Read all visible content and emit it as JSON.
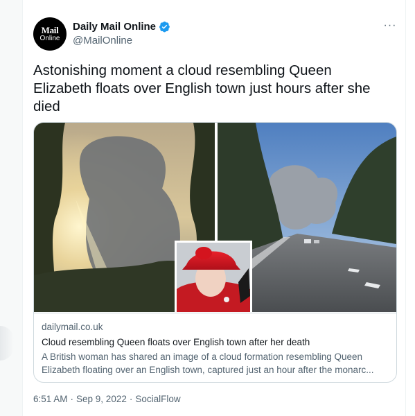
{
  "author": {
    "display_name": "Daily Mail Online",
    "handle": "@MailOnline",
    "avatar_text_line1": "Mail",
    "avatar_text_line2": "Online",
    "verified_icon": "verified-badge-icon"
  },
  "more_label": "···",
  "tweet": {
    "text": "Astonishing moment a cloud resembling Queen Elizabeth floats over English town just hours after she died"
  },
  "card": {
    "domain": "dailymail.co.uk",
    "title": "Cloud resembling Queen floats over English town after her death",
    "description_line1": "A British woman has shared an image of a cloud formation resembling Queen",
    "description_line2": "Elizabeth floating over an English town, captured just an hour after the monarc..."
  },
  "meta": {
    "time": "6:51 AM",
    "separator": "·",
    "date": "Sep 9, 2022",
    "source": "SocialFlow"
  },
  "colors": {
    "brand_blue": "#1d9bf0",
    "text_primary": "#0f1419",
    "text_secondary": "#536471",
    "border": "#cfd9de"
  }
}
